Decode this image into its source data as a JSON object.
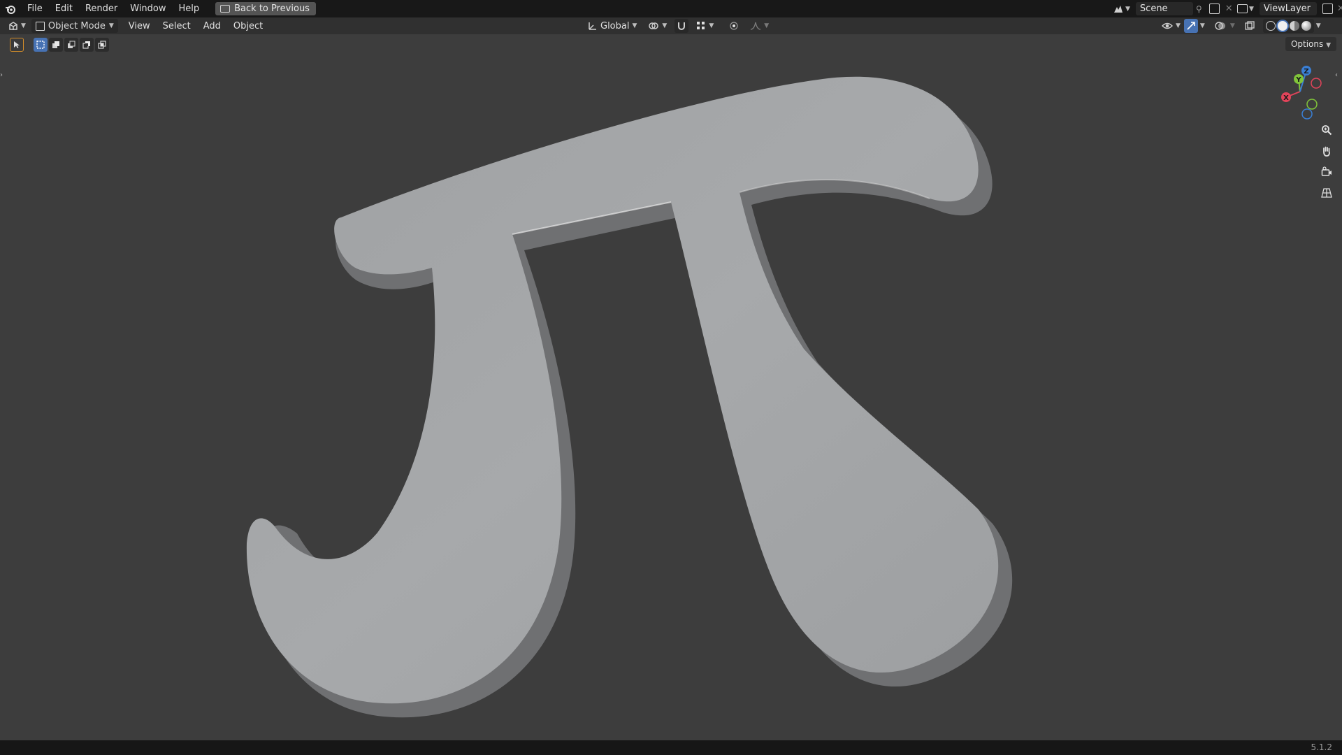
{
  "menu": {
    "items": [
      {
        "label": "File"
      },
      {
        "label": "Edit"
      },
      {
        "label": "Render"
      },
      {
        "label": "Window"
      },
      {
        "label": "Help"
      }
    ],
    "back_button": "Back to Previous"
  },
  "scene": {
    "name": "Scene",
    "view_layer": "ViewLayer"
  },
  "header": {
    "mode": "Object Mode",
    "menus": [
      {
        "label": "View"
      },
      {
        "label": "Select"
      },
      {
        "label": "Add"
      },
      {
        "label": "Object"
      }
    ],
    "transform_orientation": "Global"
  },
  "viewport": {
    "options_label": "Options",
    "gizmo_axes": {
      "x": "X",
      "y": "Y",
      "z": "Z"
    },
    "object_glyph": "π",
    "colors": {
      "background": "#3d3d3d",
      "object_face": "#a4a6a8",
      "object_side": "#6f7072",
      "axis_x": "#e2445a",
      "axis_y": "#80c43a",
      "axis_z": "#3a7fd5"
    }
  },
  "status": {
    "version": "5.1.2"
  }
}
